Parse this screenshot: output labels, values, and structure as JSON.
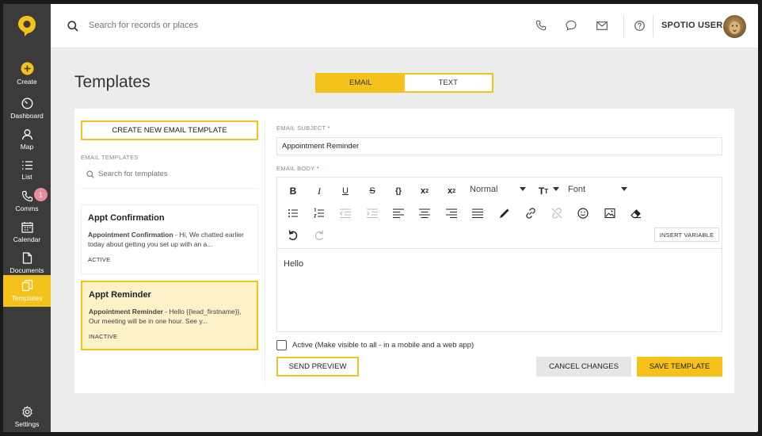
{
  "sidebar": {
    "items": [
      {
        "label": "Create",
        "icon": "plus-circle-icon"
      },
      {
        "label": "Dashboard",
        "icon": "gauge-icon"
      },
      {
        "label": "Map",
        "icon": "person-pin-icon"
      },
      {
        "label": "List",
        "icon": "list-icon"
      },
      {
        "label": "Comms",
        "icon": "phone-icon",
        "badge": "1"
      },
      {
        "label": "Calendar",
        "icon": "calendar-icon"
      },
      {
        "label": "Documents",
        "icon": "document-icon"
      },
      {
        "label": "Templates",
        "icon": "templates-icon",
        "active": true
      },
      {
        "label": "Settings",
        "icon": "gear-icon"
      }
    ]
  },
  "topbar": {
    "search_placeholder": "Search for records or places",
    "user_name": "SPOTIO USER"
  },
  "page": {
    "title": "Templates"
  },
  "tabs": [
    {
      "label": "EMAIL",
      "active": true
    },
    {
      "label": "TEXT",
      "active": false
    }
  ],
  "template_list": {
    "create_button": "CREATE NEW EMAIL TEMPLATE",
    "section_label": "EMAIL TEMPLATES",
    "search_placeholder": "Search for templates",
    "items": [
      {
        "title": "Appt Confirmation",
        "preview_bold": "Appointment Confirmation",
        "preview_text": " - Hi, We chatted earlier today about getting you set up with an a...",
        "status": "ACTIVE"
      },
      {
        "title": "Appt Reminder",
        "preview_bold": "Appointment Reminder",
        "preview_text": " - Hello {{lead_firstname}}, Our meeting will be in one hour. See y...",
        "status": "INACTIVE",
        "selected": true
      }
    ]
  },
  "editor": {
    "subject_label": "EMAIL SUBJECT",
    "subject_value": "Appointment Reminder",
    "body_label": "EMAIL BODY",
    "required_mark": "*",
    "paragraph_style": "Normal",
    "font_select": "Font",
    "insert_variable": "INSERT VARIABLE",
    "body_text": "Hello"
  },
  "footer": {
    "active_label": "Active (Make visible to all - in a mobile and a web app)",
    "send_preview": "SEND PREVIEW",
    "cancel": "CANCEL CHANGES",
    "save": "SAVE TEMPLATE"
  },
  "colors": {
    "accent": "#f5c21c",
    "sidebar": "#3b3b3b",
    "selected_card": "#fdf2c7",
    "badge": "#e88b9b"
  }
}
